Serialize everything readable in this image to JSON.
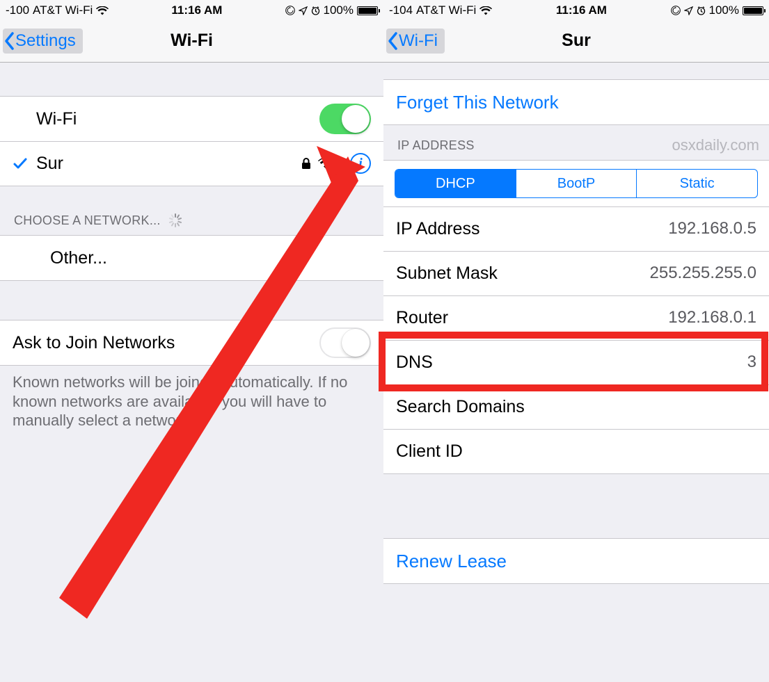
{
  "left": {
    "status": {
      "signal": "-100",
      "carrier": "AT&T Wi-Fi",
      "time": "11:16 AM",
      "battery_pct": "100%"
    },
    "nav": {
      "back": "Settings",
      "title": "Wi-Fi"
    },
    "wifi_toggle_label": "Wi-Fi",
    "connected_network": "Sur",
    "choose_header": "CHOOSE A NETWORK...",
    "other_label": "Other...",
    "ask_join_label": "Ask to Join Networks",
    "ask_join_footer": "Known networks will be joined automatically. If no known networks are available, you will have to manually select a network."
  },
  "right": {
    "status": {
      "signal": "-104",
      "carrier": "AT&T Wi-Fi",
      "time": "11:16 AM",
      "battery_pct": "100%"
    },
    "nav": {
      "back": "Wi-Fi",
      "title": "Sur"
    },
    "forget_label": "Forget This Network",
    "ip_header": "IP ADDRESS",
    "watermark": "osxdaily.com",
    "segments": {
      "dhcp": "DHCP",
      "bootp": "BootP",
      "static": "Static"
    },
    "rows": {
      "ip_label": "IP Address",
      "ip_value": "192.168.0.5",
      "subnet_label": "Subnet Mask",
      "subnet_value": "255.255.255.0",
      "router_label": "Router",
      "router_value": "192.168.0.1",
      "dns_label": "DNS",
      "dns_value": "3",
      "search_label": "Search Domains",
      "search_value": "",
      "client_label": "Client ID",
      "client_value": ""
    },
    "renew_label": "Renew Lease"
  }
}
